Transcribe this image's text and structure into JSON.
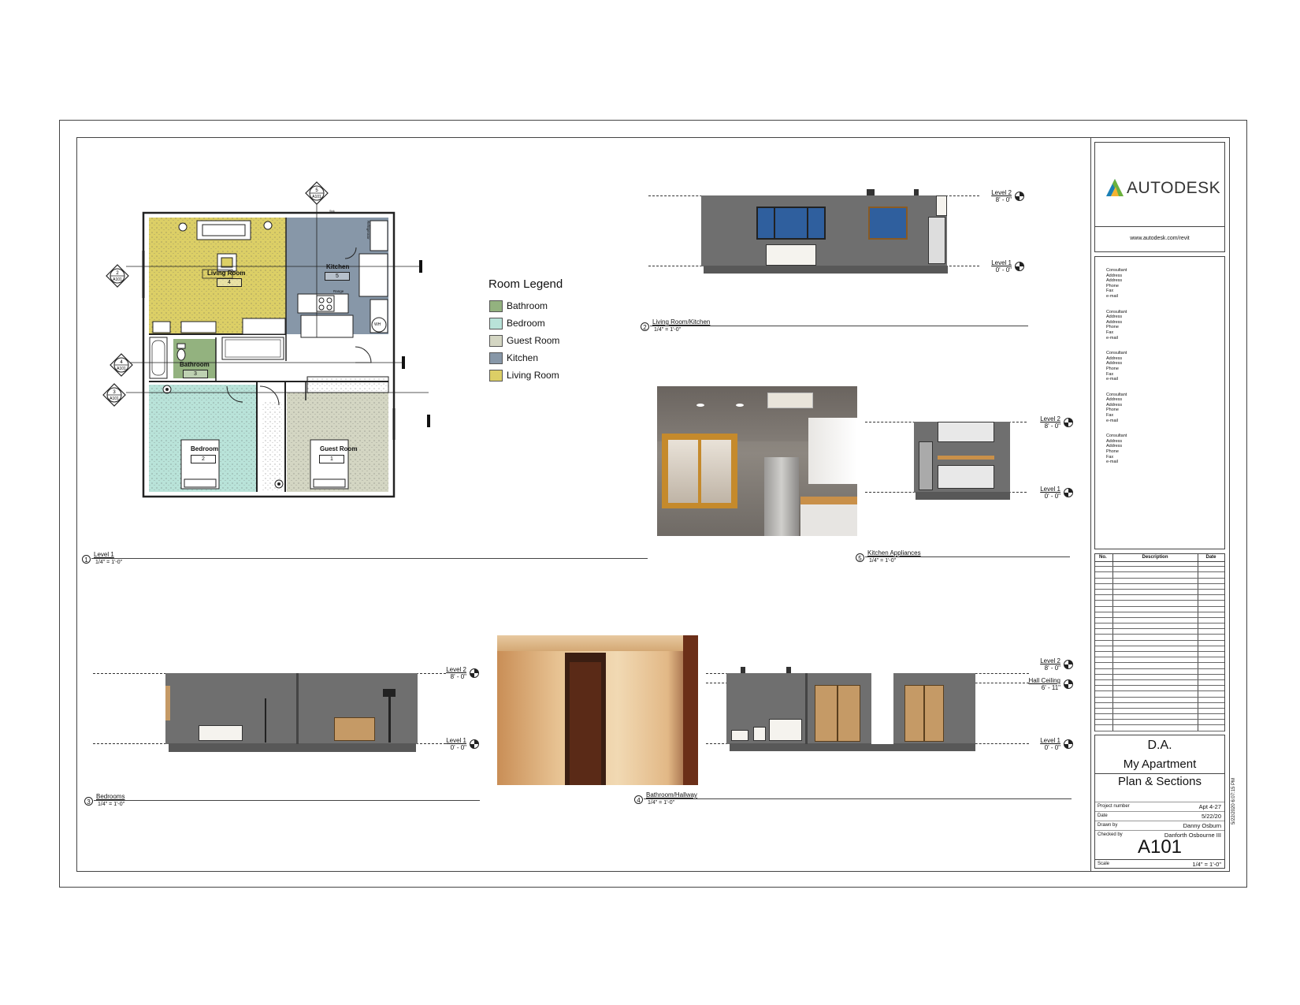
{
  "colors": {
    "bathroom": "#93b27f",
    "bedroom": "#b9e3d9",
    "guest_room": "#d4d6c3",
    "kitchen": "#8797a8",
    "living_room": "#dccf66",
    "sheet_line": "#444444",
    "section_wall": "#6f6f6f",
    "window_blue": "#2f5f9e",
    "door_wood": "#c59a66"
  },
  "legend": {
    "title": "Room Legend",
    "items": [
      {
        "label": "Bathroom",
        "color": "#93b27f"
      },
      {
        "label": "Bedroom",
        "color": "#b9e3d9"
      },
      {
        "label": "Guest Room",
        "color": "#d4d6c3"
      },
      {
        "label": "Kitchen",
        "color": "#8797a8"
      },
      {
        "label": "Living Room",
        "color": "#dccf66"
      }
    ]
  },
  "plan": {
    "rooms": {
      "living_room": {
        "name": "Living Room",
        "number": "4"
      },
      "kitchen": {
        "name": "Kitchen",
        "number": "5"
      },
      "bathroom": {
        "name": "Bathroom",
        "number": "3"
      },
      "bedroom": {
        "name": "Bedroom",
        "number": "2"
      },
      "guest_room": {
        "name": "Guest Room",
        "number": "1"
      }
    },
    "fixtures": {
      "refrigerator": "Refrigerator",
      "range": "Range",
      "water_heater": "WH",
      "sink": "Sink"
    },
    "section_tags": {
      "top": {
        "num": "5",
        "sheet": "A101"
      },
      "left_upper": {
        "num": "2",
        "sheet": "A101"
      },
      "left_middle": {
        "num": "4",
        "sheet": "A101"
      },
      "left_lower": {
        "num": "3",
        "sheet": "A101"
      }
    }
  },
  "views": {
    "v1": {
      "num": "1",
      "name": "Level 1",
      "scale": "1/4\" = 1'-0\""
    },
    "v2": {
      "num": "2",
      "name": "Living Room/Kitchen",
      "scale": "1/4\" = 1'-0\""
    },
    "v3": {
      "num": "3",
      "name": "Bedrooms",
      "scale": "1/4\" = 1'-0\""
    },
    "v4": {
      "num": "4",
      "name": "Bathroom/Hallway",
      "scale": "1/4\" = 1'-0\""
    },
    "v5": {
      "num": "5",
      "name": "Kitchen Appliances",
      "scale": "1/4\" = 1'-0\""
    }
  },
  "levels": {
    "level2": {
      "name": "Level 2",
      "elev": "8' - 0\""
    },
    "level1": {
      "name": "Level 1",
      "elev": "0' - 0\""
    },
    "hall_ceiling": {
      "name": "Hall Ceiling",
      "elev": "6' - 11\""
    }
  },
  "title_block": {
    "logo_text": "AUTODESK",
    "website": "www.autodesk.com/revit",
    "consultants": [
      [
        "Consultant",
        "Address",
        "Address",
        "Phone",
        "Fax",
        "e-mail"
      ],
      [
        "Consultant",
        "Address",
        "Address",
        "Phone",
        "Fax",
        "e-mail"
      ],
      [
        "Consultant",
        "Address",
        "Address",
        "Phone",
        "Fax",
        "e-mail"
      ],
      [
        "Consultant",
        "Address",
        "Address",
        "Phone",
        "Fax",
        "e-mail"
      ],
      [
        "Consultant",
        "Address",
        "Address",
        "Phone",
        "Fax",
        "e-mail"
      ]
    ],
    "revisions_header": {
      "no": "No.",
      "description": "Description",
      "date": "Date"
    },
    "client": "D.A.",
    "project": "My Apartment",
    "sheet_name": "Plan & Sections",
    "fields": [
      {
        "label": "Project number",
        "value": "Apt 4-27"
      },
      {
        "label": "Date",
        "value": "5/22/20"
      },
      {
        "label": "Drawn by",
        "value": "Danny Osburn"
      },
      {
        "label": "Checked by",
        "value": "Danforth Osbourne III"
      }
    ],
    "sheet_number": "A101",
    "scale_label": "Scale",
    "scale_value": "1/4\" = 1'-0\"",
    "timestamp": "5/22/2020 6:07:15 PM"
  }
}
